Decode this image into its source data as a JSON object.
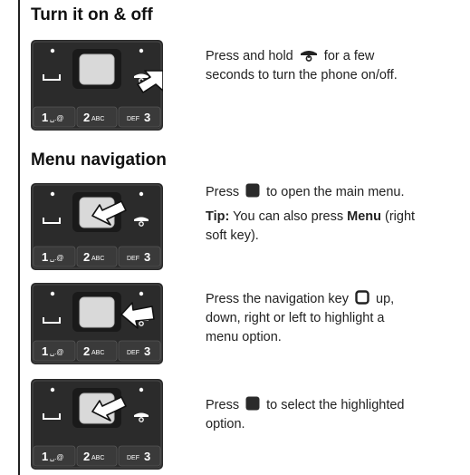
{
  "section_power": {
    "heading": "Turn it on & off",
    "text_before_icon": "Press and hold",
    "text_after_icon": "for a few",
    "text_line2": "seconds to turn the phone on/off.",
    "icon": "end-power-key-icon"
  },
  "section_menu": {
    "heading": "Menu navigation",
    "step1": {
      "text_before_icon": "Press",
      "text_after_icon": "to open the main menu.",
      "icon": "center-select-key-icon",
      "tip_label": "Tip:",
      "tip_text_before": "You can also press",
      "tip_menu_word": "Menu",
      "tip_text_after": "(right",
      "tip_line2": "soft key)."
    },
    "step2": {
      "text_before_icon": "Press the navigation key",
      "text_after_icon": "up,",
      "text_line2": "down, right or left to highlight a",
      "text_line3": "menu option.",
      "icon": "navigation-key-icon"
    },
    "step3": {
      "text_before_icon": "Press",
      "text_after_icon": "to select the highlighted",
      "text_line2": "option.",
      "icon": "center-select-key-icon"
    }
  },
  "keypad": {
    "key1_digit": "1",
    "key1_symbols": "␣.@",
    "key2_digit": "2",
    "key2_letters": "ABC",
    "key3_letters": "DEF",
    "key3_digit": "3"
  },
  "colors": {
    "phone_body": "#2b2b2b",
    "keys": "#3a3a3a",
    "center_key": "#d9d9d9",
    "arrow": "#ffffff"
  }
}
